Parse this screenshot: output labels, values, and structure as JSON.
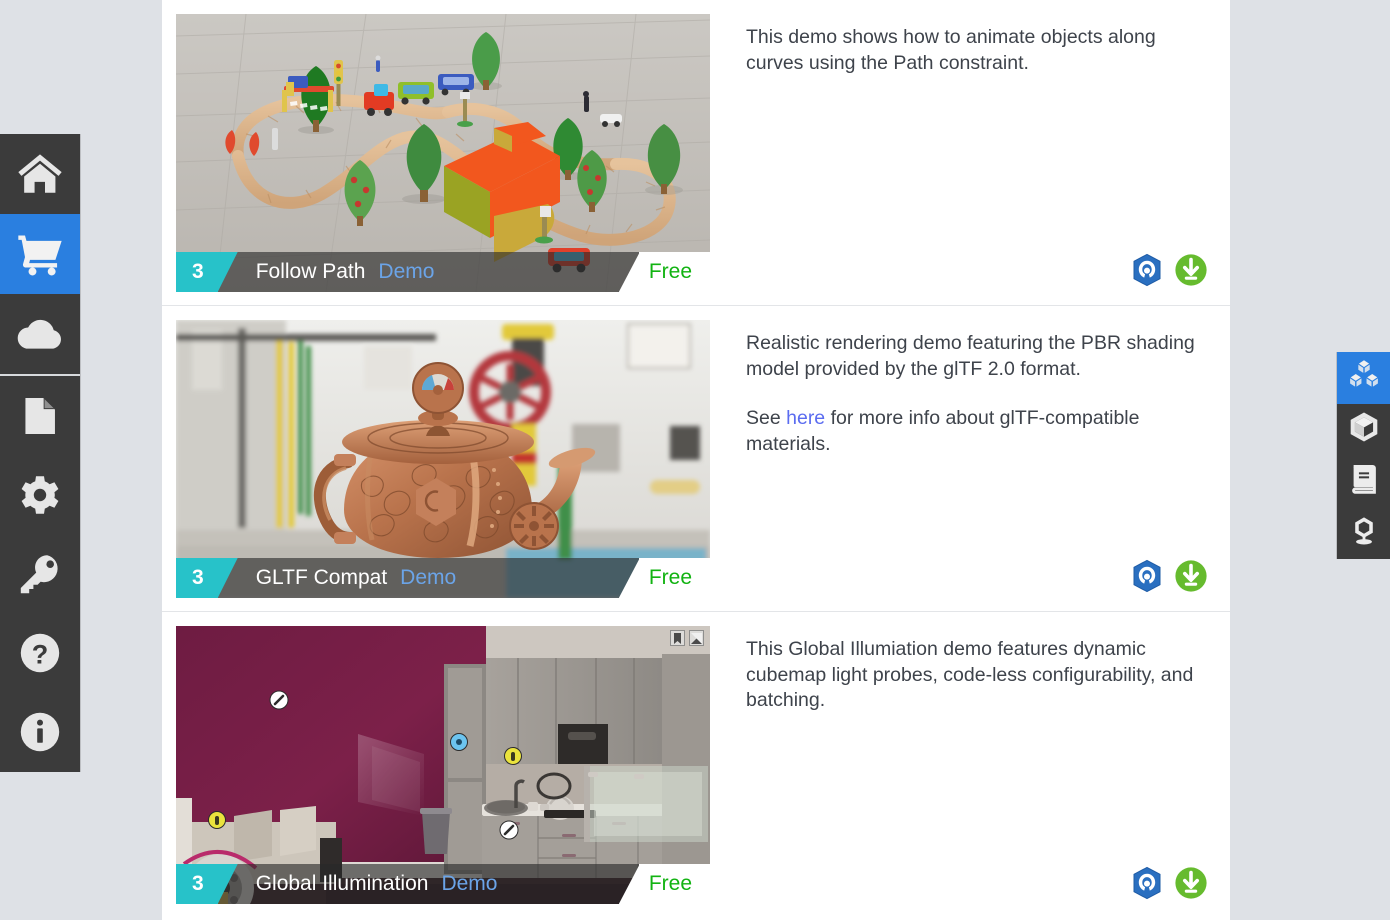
{
  "window": {
    "background_color": "#dee1e6",
    "panel_color": "#ffffff"
  },
  "left_sidebar": {
    "accent_color": "#2a7fe0",
    "background_color": "#3b3b3b",
    "items": [
      {
        "icon": "home-icon",
        "label": "Home",
        "active": false
      },
      {
        "icon": "cart-icon",
        "label": "Asset Store",
        "active": true
      },
      {
        "icon": "cloud-icon",
        "label": "Cloud",
        "active": false
      },
      {
        "icon": "document-icon",
        "label": "Documents",
        "active": false
      },
      {
        "icon": "gear-icon",
        "label": "Settings",
        "active": false
      },
      {
        "icon": "key-icon",
        "label": "License",
        "active": false
      },
      {
        "icon": "help-icon",
        "label": "Help",
        "active": false
      },
      {
        "icon": "info-icon",
        "label": "About",
        "active": false
      }
    ]
  },
  "right_sidebar": {
    "accent_color": "#2a7fe0",
    "background_color": "#3b3b3b",
    "items": [
      {
        "icon": "blocks-icon",
        "label": "Assets",
        "active": true
      },
      {
        "icon": "cube-icon",
        "label": "Models",
        "active": false
      },
      {
        "icon": "book-icon",
        "label": "Docs",
        "active": false
      },
      {
        "icon": "material-icon",
        "label": "Materials",
        "active": false
      }
    ]
  },
  "assets": [
    {
      "version_badge": "3",
      "title": "Follow Path",
      "kind": "Demo",
      "price": "Free",
      "thumbnail_name": "wooden-toy-train-set-thumbnail",
      "description_parts": [
        {
          "type": "text",
          "value": "This demo shows how to animate objects along curves using the Path constraint."
        }
      ],
      "actions": [
        {
          "icon": "asset-library-icon",
          "label": "Open in Asset Library"
        },
        {
          "icon": "download-icon",
          "label": "Download"
        }
      ]
    },
    {
      "version_badge": "3",
      "title": "GLTF Compat",
      "kind": "Demo",
      "price": "Free",
      "thumbnail_name": "copper-teapot-pbr-thumbnail",
      "description_parts": [
        {
          "type": "text",
          "value": "Realistic rendering demo featuring the PBR shading model provided by the glTF 2.0 format."
        },
        {
          "type": "rich",
          "before": "See ",
          "link": "here",
          "after": " for more info about glTF-compatible materials."
        }
      ],
      "actions": [
        {
          "icon": "asset-library-icon",
          "label": "Open in Asset Library"
        },
        {
          "icon": "download-icon",
          "label": "Download"
        }
      ]
    },
    {
      "version_badge": "3",
      "title": "Global Illumination",
      "kind": "Demo",
      "price": "Free",
      "thumbnail_name": "kitchen-interior-gi-thumbnail",
      "thumbnail_corner_icons": [
        {
          "icon": "bookmark-icon",
          "label": "Bookmark"
        },
        {
          "icon": "expand-icon",
          "label": "Expand"
        }
      ],
      "description_parts": [
        {
          "type": "text",
          "value": "This Global Illumiation demo features dynamic cubemap light probes, code-less configurability, and batching."
        }
      ],
      "actions": [
        {
          "icon": "asset-library-icon",
          "label": "Open in Asset Library"
        },
        {
          "icon": "download-icon",
          "label": "Download"
        }
      ]
    }
  ],
  "colors": {
    "badge_teal": "#27c2c9",
    "price_green": "#12b312",
    "kind_blue": "#6ba4e8",
    "link_blue": "#5b6cf0",
    "download_green": "#66bb2e",
    "assetlib_blue": "#2a6fc0"
  }
}
